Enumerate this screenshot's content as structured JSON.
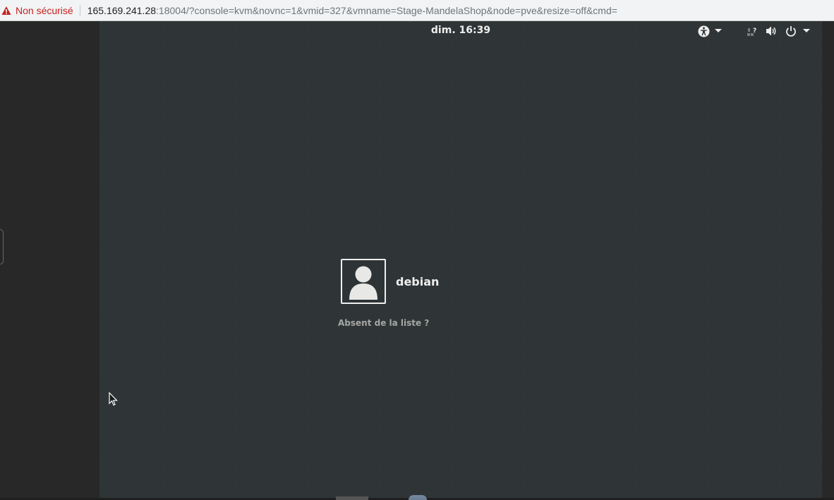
{
  "browser": {
    "security_label": "Non sécurisé",
    "url_host": "165.169.241.28",
    "url_rest": ":18004/?console=kvm&novnc=1&vmid=327&vmname=Stage-MandelaShop&node=pve&resize=off&cmd="
  },
  "topbar": {
    "clock": "dim. 16:39",
    "icons": [
      "accessibility-icon",
      "dropdown-arrow-icon",
      "network-offline-icon",
      "volume-icon",
      "power-icon",
      "dropdown-arrow-icon"
    ]
  },
  "login": {
    "username": "debian",
    "not_listed_label": "Absent de la liste ?"
  },
  "colors": {
    "vm_background": "#2e3436",
    "text_primary": "#eeeeec",
    "text_secondary": "#a6a7a3",
    "security_warning": "#c5221f"
  }
}
